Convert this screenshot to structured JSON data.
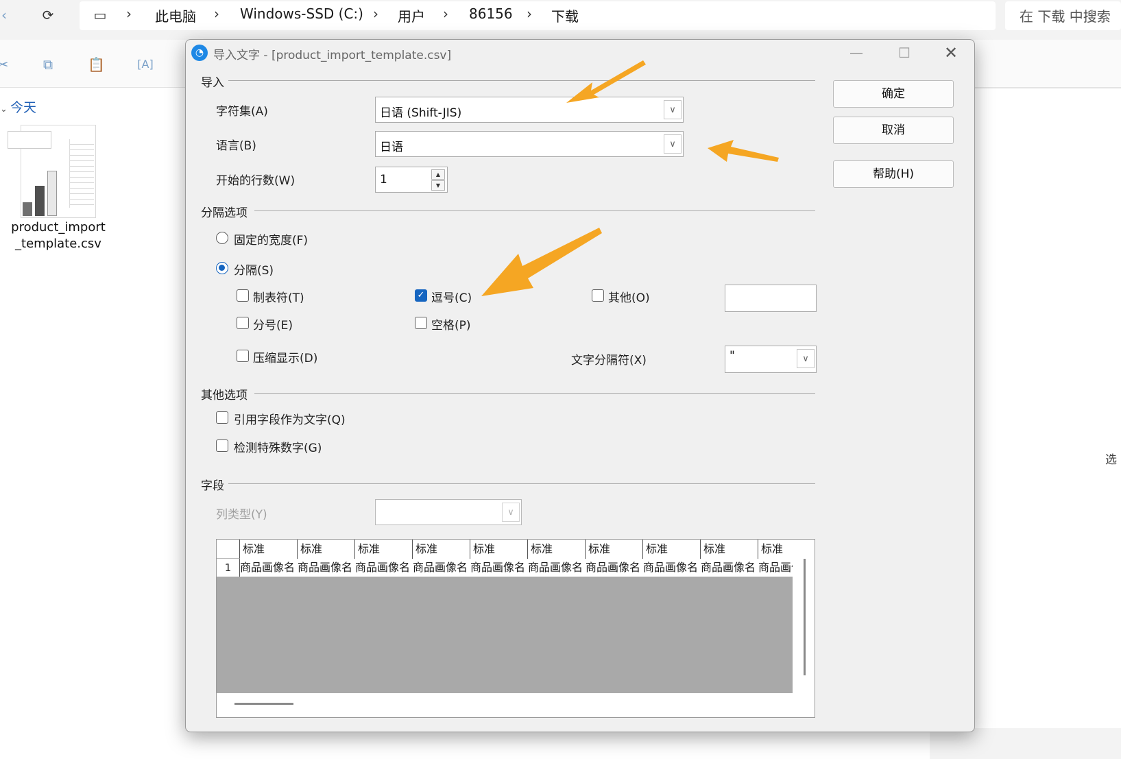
{
  "explorer": {
    "breadcrumb": [
      "此电脑",
      "Windows-SSD (C:)",
      "用户",
      "86156",
      "下载"
    ],
    "search_placeholder": "在 下载 中搜索",
    "group_label": "今天",
    "file_name": "product_import_template.csv",
    "file_name_line1": "product_import",
    "file_name_line2": "_template.csv",
    "side_text": "选"
  },
  "dialog": {
    "title": "导入文字 - [product_import_template.csv]",
    "sections": {
      "import": "导入",
      "separator_options": "分隔选项",
      "other_options": "其他选项",
      "fields": "字段"
    },
    "charset": {
      "label": "字符集(A)",
      "value": "日语 (Shift-JIS)"
    },
    "language": {
      "label": "语言(B)",
      "value": "日语"
    },
    "start_row": {
      "label": "开始的行数(W)",
      "value": "1"
    },
    "fixed_width": {
      "label": "固定的宽度(F)",
      "selected": false
    },
    "separated": {
      "label": "分隔(S)",
      "selected": true
    },
    "separators": {
      "tab": {
        "label": "制表符(T)",
        "checked": false
      },
      "comma": {
        "label": "逗号(C)",
        "checked": true
      },
      "other": {
        "label": "其他(O)",
        "checked": false,
        "value": ""
      },
      "semicolon": {
        "label": "分号(E)",
        "checked": false
      },
      "space": {
        "label": "空格(P)",
        "checked": false
      },
      "merge": {
        "label": "压缩显示(D)",
        "checked": false
      }
    },
    "text_delimiter": {
      "label": "文字分隔符(X)",
      "value": "\""
    },
    "other_opts": {
      "quoted_as_text": {
        "label": "引用字段作为文字(Q)",
        "checked": false
      },
      "detect_numbers": {
        "label": "检测特殊数字(G)",
        "checked": false
      }
    },
    "column_type": {
      "label": "列类型(Y)",
      "value": ""
    },
    "preview": {
      "headers": [
        "标准",
        "标准",
        "标准",
        "标准",
        "标准",
        "标准",
        "标准",
        "标准",
        "标准",
        "标准"
      ],
      "row_number": "1",
      "cells": [
        "商品画像名",
        "商品画像名",
        "商品画像名",
        "商品画像名",
        "商品画像名",
        "商品画像名",
        "商品画像名",
        "商品画像名",
        "商品画像名",
        "商品画像"
      ]
    },
    "buttons": {
      "ok": "确定",
      "cancel": "取消",
      "help": "帮助(H)"
    }
  },
  "colors": {
    "accent": "#1565c0",
    "arrow": "#f5a623",
    "dialog_bg": "#f0f0f0",
    "preview_fill": "#a9a9a9"
  }
}
